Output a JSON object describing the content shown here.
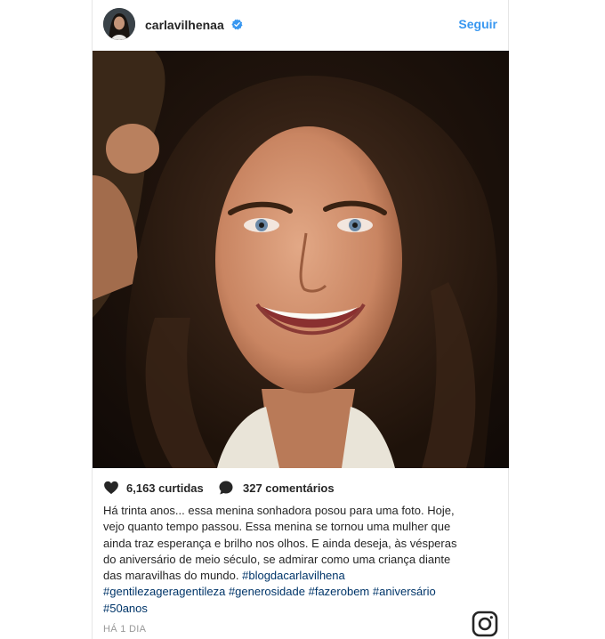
{
  "post": {
    "username": "carlavilhenaa",
    "follow_label": "Seguir",
    "likes_text": "6,163 curtidas",
    "comments_text": "327 comentários",
    "caption_text": "Há trinta anos... essa menina sonhadora posou para uma foto. Hoje, vejo quanto tempo passou. Essa menina se tornou uma mulher que ainda traz esperança e brilho nos olhos. E ainda deseja, às vésperas do aniversário de meio século, se admirar como uma criança diante das maravilhas do mundo.",
    "hashtags": [
      "#blogdacarlavilhena",
      "#gentilezageragentileza",
      "#generosidade",
      "#fazerobem",
      "#aniversário",
      "#50anos"
    ],
    "time_label": "HÁ 1 DIA"
  },
  "icons": {
    "avatar": "avatar",
    "verified": "verified-badge-icon",
    "like": "heart-icon",
    "comment": "comment-bubble-icon",
    "instagram": "instagram-logo-icon"
  },
  "colors": {
    "link": "#3897f0",
    "hashtag": "#003569",
    "text": "#262626",
    "muted": "#999999"
  }
}
